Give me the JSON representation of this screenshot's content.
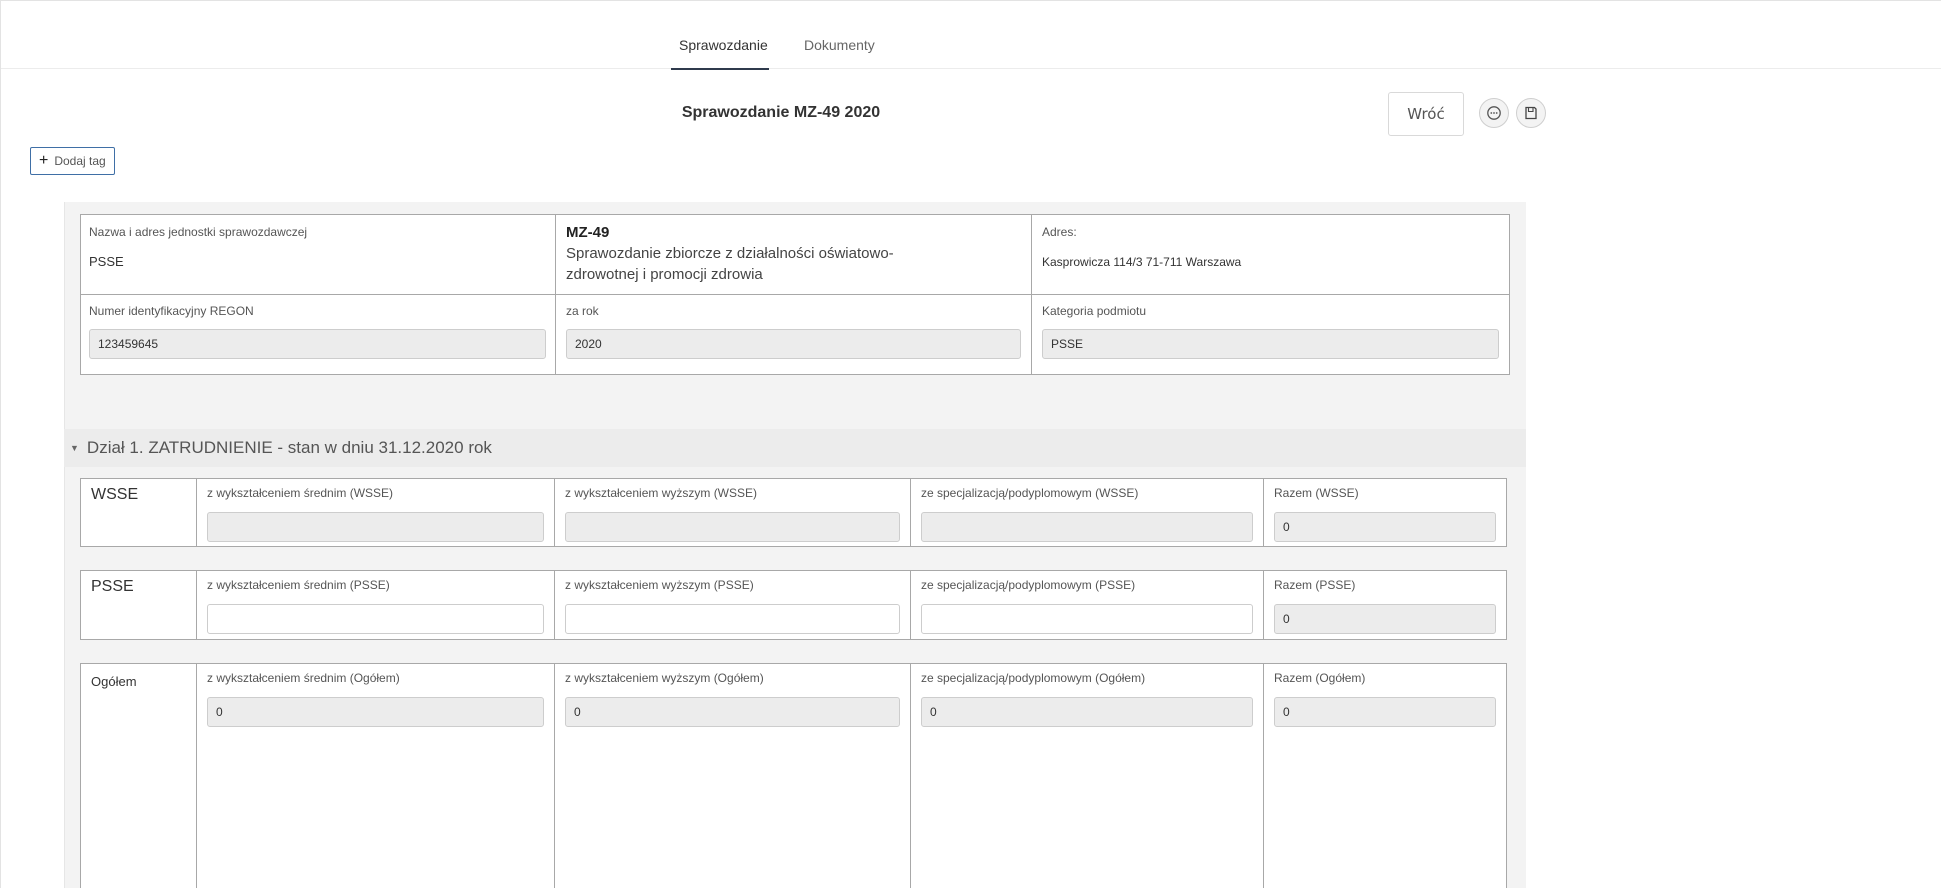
{
  "tabs": [
    {
      "label": "Sprawozdanie",
      "active": true
    },
    {
      "label": "Dokumenty",
      "active": false
    }
  ],
  "header": {
    "title": "Sprawozdanie MZ-49 2020",
    "back_label": "Wróć",
    "add_tag_label": "Dodaj tag"
  },
  "form_header": {
    "unit_label": "Nazwa i adres jednostki sprawozdawczej",
    "unit_value": "PSSE",
    "form_code": "MZ-49",
    "form_desc": "Sprawozdanie zbiorcze z działalności oświatowo-zdrowotnej i promocji zdrowia",
    "address_label": "Adres:",
    "address_value": "Kasprowicza 114/3 71-711 Warszawa",
    "regon_label": "Numer identyfikacyjny REGON",
    "regon_value": "123459645",
    "year_label": "za rok",
    "year_value": "2020",
    "category_label": "Kategoria podmiotu",
    "category_value": "PSSE"
  },
  "section1": {
    "title": "Dział 1. ZATRUDNIENIE - stan w dniu 31.12.2020 rok",
    "rows": [
      {
        "name": "WSSE",
        "fields": [
          {
            "label": "z wykształceniem średnim (WSSE)",
            "value": ""
          },
          {
            "label": "z wykształceniem wyższym (WSSE)",
            "value": ""
          },
          {
            "label": "ze specjalizacją/podyplomowym (WSSE)",
            "value": ""
          },
          {
            "label": "Razem (WSSE)",
            "value": "0"
          }
        ]
      },
      {
        "name": "PSSE",
        "fields": [
          {
            "label": "z wykształceniem średnim (PSSE)",
            "value": ""
          },
          {
            "label": "z wykształceniem wyższym (PSSE)",
            "value": ""
          },
          {
            "label": "ze specjalizacją/podyplomowym (PSSE)",
            "value": ""
          },
          {
            "label": "Razem (PSSE)",
            "value": "0"
          }
        ]
      },
      {
        "name": "Ogółem",
        "fields": [
          {
            "label": "z wykształceniem średnim (Ogółem)",
            "value": "0"
          },
          {
            "label": "z wykształceniem wyższym (Ogółem)",
            "value": "0"
          },
          {
            "label": "ze specjalizacją/podyplomowym (Ogółem)",
            "value": "0"
          },
          {
            "label": "Razem (Ogółem)",
            "value": "0"
          }
        ]
      }
    ]
  },
  "icons": {
    "comment": "comment-icon",
    "save": "save-icon",
    "plus": "plus-icon",
    "caret": "caret-down-icon"
  },
  "colors": {
    "tab_underline": "#2f3a4c",
    "tag_border": "#3f6fa6",
    "panel_bg": "#f3f3f3",
    "readonly_field": "#ececec"
  }
}
